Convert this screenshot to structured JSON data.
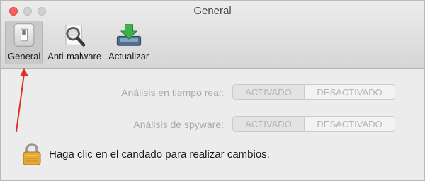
{
  "window": {
    "title": "General"
  },
  "toolbar": {
    "items": [
      {
        "label": "General",
        "icon": "switch-icon",
        "selected": true
      },
      {
        "label": "Anti-malware",
        "icon": "magnifier-icon",
        "selected": false
      },
      {
        "label": "Actualizar",
        "icon": "download-icon",
        "selected": false
      }
    ]
  },
  "settings": {
    "realtime": {
      "label": "Análisis en tiempo real:",
      "on": "ACTIVADO",
      "off": "DESACTIVADO"
    },
    "spyware": {
      "label": "Análisis de spyware:",
      "on": "ACTIVADO",
      "off": "DESACTIVADO"
    }
  },
  "lock": {
    "text": "Haga clic en el candado para realizar cambios."
  },
  "annotation": {
    "color": "#e0302a"
  },
  "colors": {
    "close": "#fc605b",
    "install_green": "#3bb34a"
  }
}
